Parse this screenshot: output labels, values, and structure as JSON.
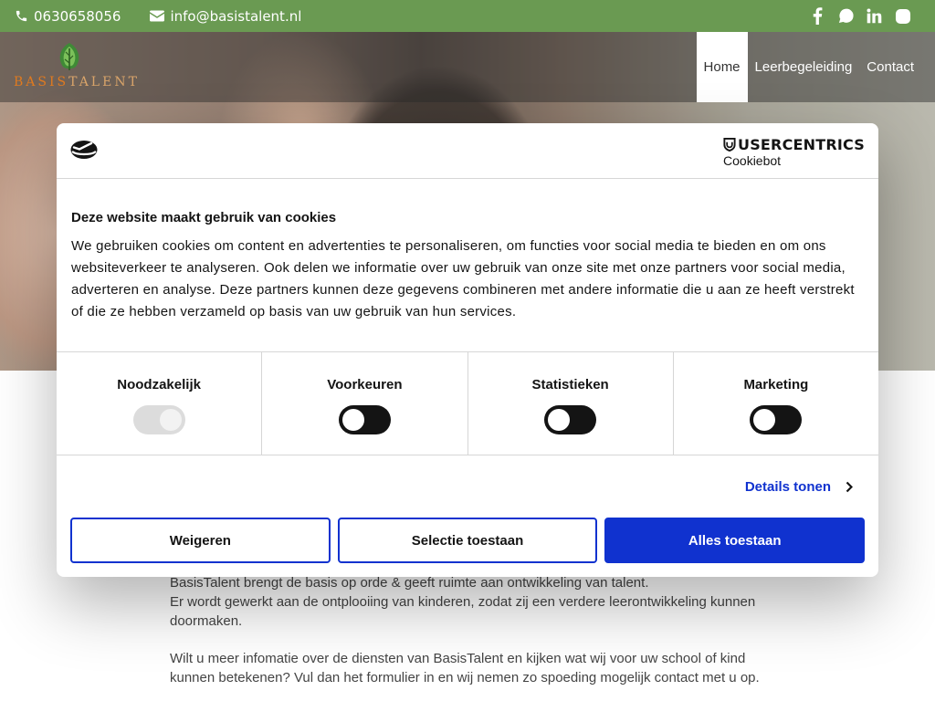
{
  "topbar": {
    "phone": "0630658056",
    "email": "info@basistalent.nl",
    "social_icons": [
      "facebook-icon",
      "whatsapp-icon",
      "linkedin-icon",
      "instagram-icon"
    ]
  },
  "logo": {
    "text_part1": "BASIS",
    "text_part2": "TALENT"
  },
  "nav": {
    "items": [
      {
        "label": "Home"
      },
      {
        "label": "Leerbegeleiding"
      },
      {
        "label": "Contact"
      }
    ]
  },
  "cookie_dialog": {
    "brand": "USERCENTRICS",
    "brand_sub": "Cookiebot",
    "title": "Deze website maakt gebruik van cookies",
    "text": "We gebruiken cookies om content en advertenties te personaliseren, om functies voor social media te bieden en om ons websiteverkeer te analyseren. Ook delen we informatie over uw gebruik van onze site met onze partners voor social media, adverteren en analyse. Deze partners kunnen deze gegevens combineren met andere informatie die u aan ze heeft verstrekt of die ze hebben verzameld op basis van uw gebruik van hun services.",
    "toggles": [
      {
        "label": "Noodzakelijk"
      },
      {
        "label": "Voorkeuren"
      },
      {
        "label": "Statistieken"
      },
      {
        "label": "Marketing"
      }
    ],
    "details_label": "Details tonen",
    "buttons": {
      "reject": "Weigeren",
      "selection": "Selectie toestaan",
      "allow_all": "Alles toestaan"
    }
  },
  "content": {
    "para1_line1": "BasisTalent brengt de basis op orde & geeft ruimte aan ontwikkeling van talent.",
    "para1_line2": "Er wordt gewerkt aan de ontplooiing van kinderen, zodat zij een verdere leerontwikkeling kunnen doormaken.",
    "para2": "Wilt u meer infomatie over de diensten van BasisTalent en kijken wat wij voor uw school of kind kunnen betekenen? Vul dan het formulier in en wij nemen zo spoeding mogelijk contact met u op."
  },
  "colors": {
    "topbar": "#6a9a52",
    "accent_blue": "#1032cf"
  }
}
